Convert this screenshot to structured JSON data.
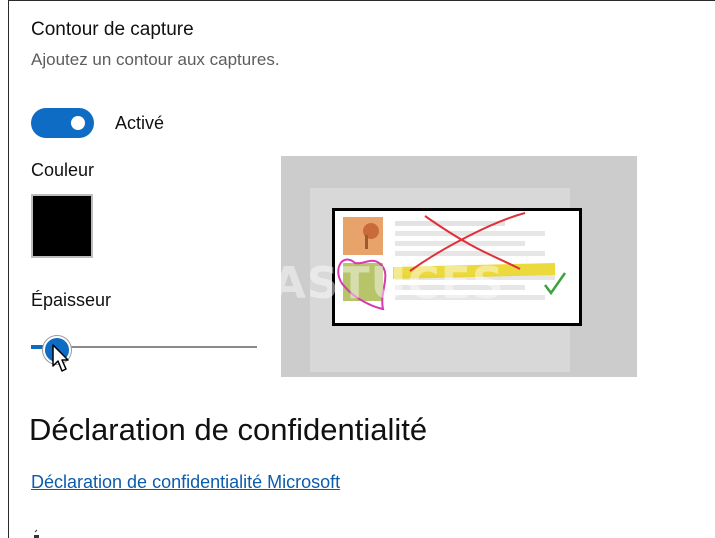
{
  "capture_border": {
    "title": "Contour de capture",
    "description": "Ajoutez un contour aux captures.",
    "toggle": {
      "state": "on",
      "label": "Activé"
    },
    "color": {
      "label": "Couleur",
      "value": "#000000"
    },
    "thickness": {
      "label": "Épaisseur",
      "value": 0.1
    }
  },
  "preview": {
    "watermark": "PC ASTUCES"
  },
  "privacy": {
    "title": "Déclaration de confidentialité",
    "link": "Déclaration de confidentialité Microsoft"
  },
  "colors": {
    "accent": "#0f6cc4",
    "link": "#0b5cad"
  }
}
